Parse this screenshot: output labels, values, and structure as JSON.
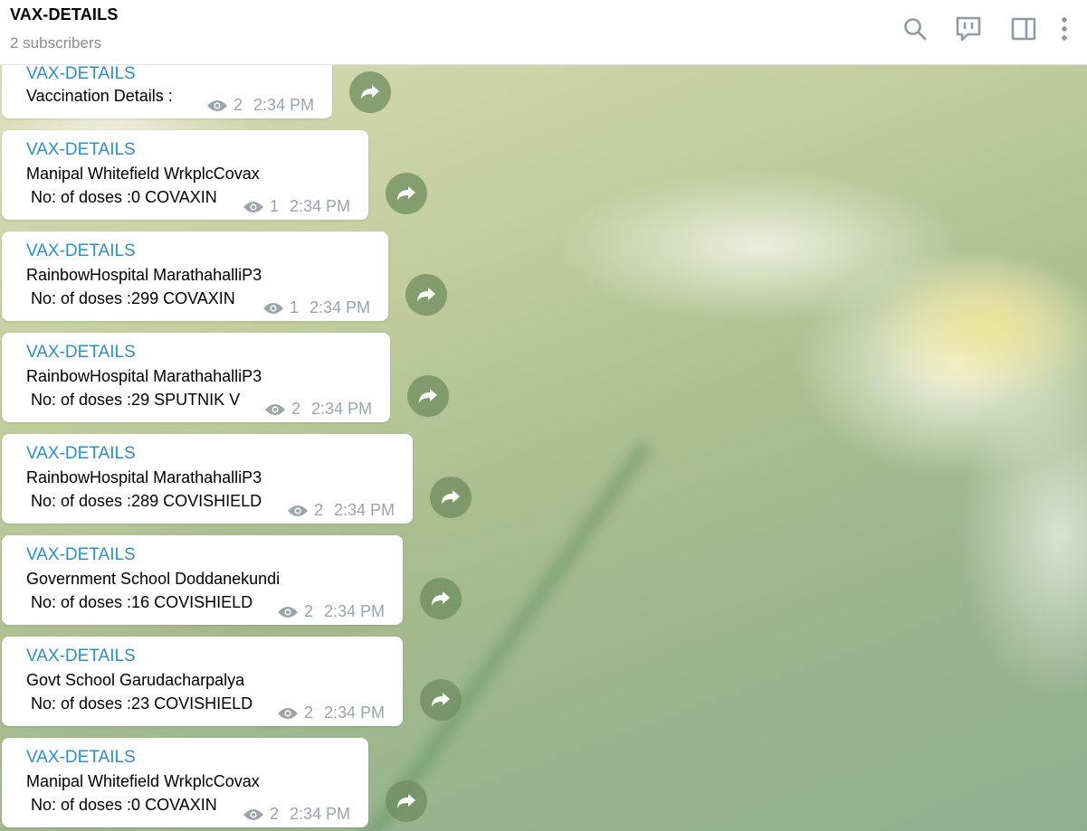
{
  "header": {
    "title": "VAX-DETAILS",
    "subtitle": "2 subscribers",
    "icons": [
      "search-icon",
      "discuss-icon",
      "sidebar-toggle-icon",
      "more-vertical-icon"
    ]
  },
  "messages": [
    {
      "sender": "VAX-DETAILS",
      "line1": "Vaccination Details :",
      "line2": "",
      "views": "2",
      "time": "2:34 PM"
    },
    {
      "sender": "VAX-DETAILS",
      "line1": "Manipal Whitefield WrkplcCovax",
      "line2": " No: of doses :0 COVAXIN",
      "views": "1",
      "time": "2:34 PM"
    },
    {
      "sender": "VAX-DETAILS",
      "line1": "RainbowHospital MarathahalliP3",
      "line2": " No: of doses :299 COVAXIN",
      "views": "1",
      "time": "2:34 PM"
    },
    {
      "sender": "VAX-DETAILS",
      "line1": "RainbowHospital MarathahalliP3",
      "line2": " No: of doses :29 SPUTNIK V",
      "views": "2",
      "time": "2:34 PM"
    },
    {
      "sender": "VAX-DETAILS",
      "line1": "RainbowHospital MarathahalliP3",
      "line2": " No: of doses :289 COVISHIELD",
      "views": "2",
      "time": "2:34 PM"
    },
    {
      "sender": "VAX-DETAILS",
      "line1": "Government School Doddanekundi",
      "line2": " No: of doses :16 COVISHIELD",
      "views": "2",
      "time": "2:34 PM"
    },
    {
      "sender": "VAX-DETAILS",
      "line1": "Govt School Garudacharpalya",
      "line2": " No: of doses :23 COVISHIELD",
      "views": "2",
      "time": "2:34 PM"
    },
    {
      "sender": "VAX-DETAILS",
      "line1": "Manipal Whitefield WrkplcCovax",
      "line2": " No: of doses :0 COVAXIN",
      "views": "2",
      "time": "2:34 PM"
    }
  ],
  "colors": {
    "sender": "#2b8ecc",
    "meta": "#9aa4ad",
    "icon": "#8e9aa4"
  }
}
